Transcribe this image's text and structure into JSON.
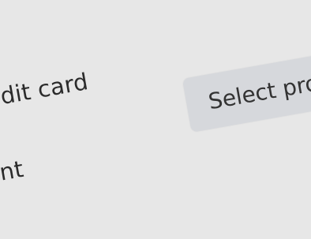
{
  "payment_methods": {
    "card_label": "nt / credit card",
    "account_label": "account"
  },
  "provider_select": {
    "label": "Select pro"
  }
}
